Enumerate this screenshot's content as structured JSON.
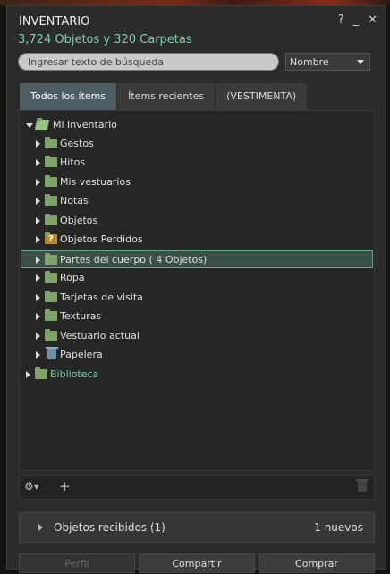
{
  "window": {
    "title": "INVENTARIO",
    "help": "?",
    "minimize": "_",
    "close": "✕",
    "summary": "3,724 Objetos y 320 Carpetas"
  },
  "search": {
    "placeholder": "Ingresar texto de búsqueda"
  },
  "sort": {
    "selected": "Nombre"
  },
  "tabs": [
    {
      "label": "Todos los ítems",
      "active": true
    },
    {
      "label": "Ítems recientes",
      "active": false
    },
    {
      "label": "(VESTIMENTA)",
      "active": false
    }
  ],
  "tree": {
    "root": "Mi Inventario",
    "items": [
      {
        "label": "Gestos",
        "icon": "folder-icon"
      },
      {
        "label": "Hitos",
        "icon": "folder-icon"
      },
      {
        "label": "Mis vestuarios",
        "icon": "folder-icon"
      },
      {
        "label": "Notas",
        "icon": "folder-icon"
      },
      {
        "label": "Objetos",
        "icon": "folder-icon"
      },
      {
        "label": "Objetos Perdidos",
        "icon": "lost-folder-icon"
      },
      {
        "label": "Partes del cuerpo ( 4 Objetos)",
        "icon": "folder-icon",
        "selected": true
      },
      {
        "label": "Ropa",
        "icon": "folder-icon"
      },
      {
        "label": "Tarjetas de visita",
        "icon": "folder-icon"
      },
      {
        "label": "Texturas",
        "icon": "folder-icon"
      },
      {
        "label": "Vestuario actual",
        "icon": "folder-icon"
      },
      {
        "label": "Papelera",
        "icon": "trash-icon"
      }
    ],
    "library": "Biblioteca"
  },
  "toolbar": {
    "gear": "⚙▾",
    "add": "+"
  },
  "received": {
    "label": "Objetos recibidos (1)",
    "count": "1 nuevos"
  },
  "actions": {
    "profile": "Perfil",
    "share": "Compartir",
    "buy": "Comprar"
  },
  "colors": {
    "accent": "#7fcfa8",
    "selection": "#3a4f45",
    "active_tab": "#4e5d61"
  }
}
